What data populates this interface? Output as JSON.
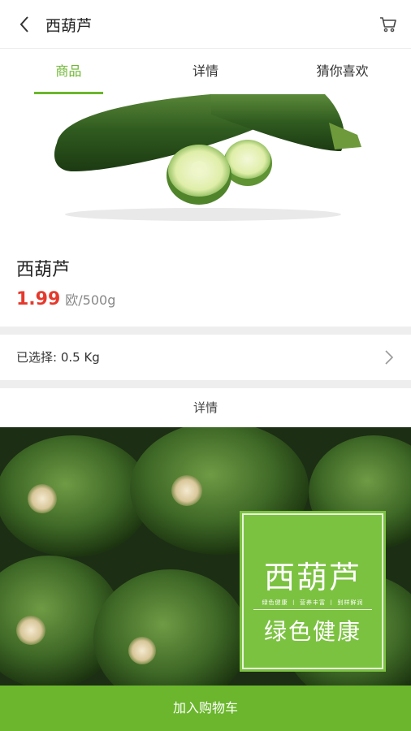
{
  "header": {
    "title": "西葫芦",
    "back_icon": "chevron-left-icon",
    "cart_icon": "cart-icon"
  },
  "tabs": [
    {
      "label": "商品",
      "active": true
    },
    {
      "label": "详情",
      "active": false
    },
    {
      "label": "猜你喜欢",
      "active": false
    }
  ],
  "product": {
    "name": "西葫芦",
    "price": "1.99",
    "unit": "欧/500g"
  },
  "selection": {
    "label": "已选择: 0.5 Kg",
    "chevron_icon": "chevron-right-icon"
  },
  "details": {
    "heading": "详情",
    "badge": {
      "title": "西葫芦",
      "tags": "绿色健康 丨 营养丰富 丨 别样鲜润",
      "subtitle": "绿色健康"
    }
  },
  "footer": {
    "add_to_cart": "加入购物车"
  },
  "colors": {
    "accent": "#6bb62c",
    "price": "#e4392c",
    "separator": "#eeeeee",
    "badge": "#7cc241"
  }
}
